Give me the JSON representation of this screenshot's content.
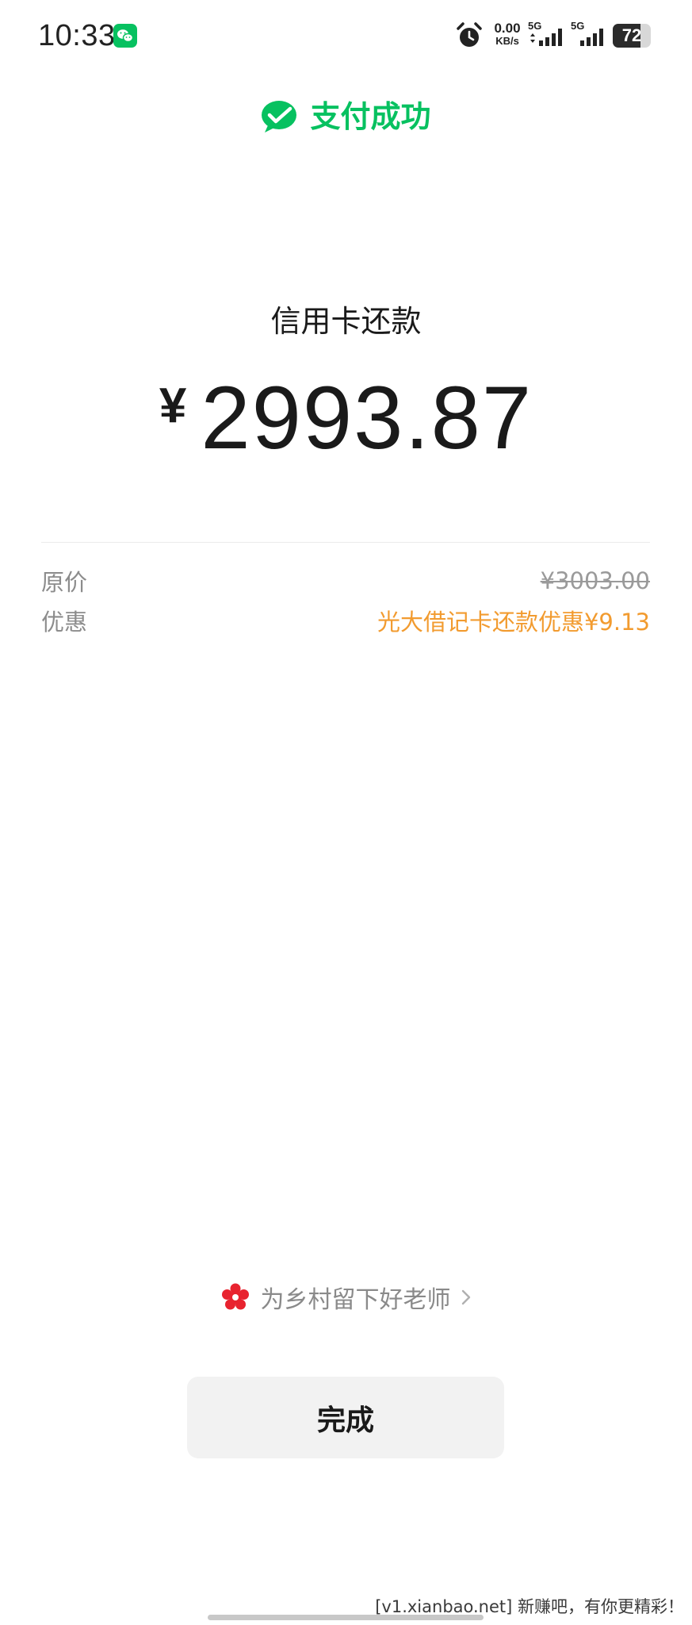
{
  "status_bar": {
    "time": "10:33",
    "net_speed_value": "0.00",
    "net_speed_unit": "KB/s",
    "signal_1_label": "5G",
    "signal_2_label": "5G",
    "battery_percent": 72
  },
  "header": {
    "title": "支付成功"
  },
  "payment": {
    "merchant": "信用卡还款",
    "currency_symbol": "¥",
    "amount": "2993.87"
  },
  "details": {
    "original_label": "原价",
    "original_value": "¥3003.00",
    "discount_label": "优惠",
    "discount_value": "光大借记卡还款优惠¥9.13"
  },
  "charity": {
    "text": "为乡村留下好老师"
  },
  "actions": {
    "done_label": "完成"
  },
  "watermark": {
    "text": "[v1.xianbao.net] 新赚吧，有你更精彩！"
  },
  "colors": {
    "brand_green": "#07c160",
    "discount_orange": "#f29b2f",
    "charity_red": "#e8232f"
  },
  "icons": {
    "notification": "wechat-icon",
    "alarm": "alarm-icon",
    "success": "wechat-pay-icon",
    "charity": "flower-icon",
    "chevron": "chevron-right-icon"
  }
}
